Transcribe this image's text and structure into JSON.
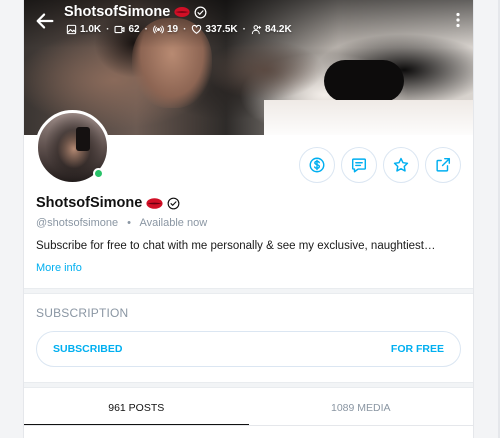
{
  "header": {
    "title": "ShotsofSimone",
    "stats": {
      "photos": "1.0K",
      "videos": "62",
      "streams": "19",
      "likes": "337.5K",
      "fans": "84.2K"
    }
  },
  "profile": {
    "name": "ShotsofSimone",
    "handle": "@shotsofsimone",
    "status": "Available now",
    "bio": "Subscribe for free to chat with me personally & see my exclusive, naughtiest…",
    "more_info": "More info"
  },
  "subscription": {
    "heading": "SUBSCRIPTION",
    "button_left": "SUBSCRIBED",
    "button_right": "FOR FREE"
  },
  "tabs": [
    {
      "label": "961 POSTS",
      "active": true
    },
    {
      "label": "1089 MEDIA",
      "active": false
    }
  ],
  "colors": {
    "accent": "#00aff0",
    "online": "#29c269",
    "muted": "#8a96a3"
  },
  "icons": {
    "back": "arrow-left-icon",
    "menu": "kebab-menu-icon",
    "tip": "dollar-icon",
    "message": "message-icon",
    "favorite": "star-icon",
    "share": "share-icon"
  }
}
